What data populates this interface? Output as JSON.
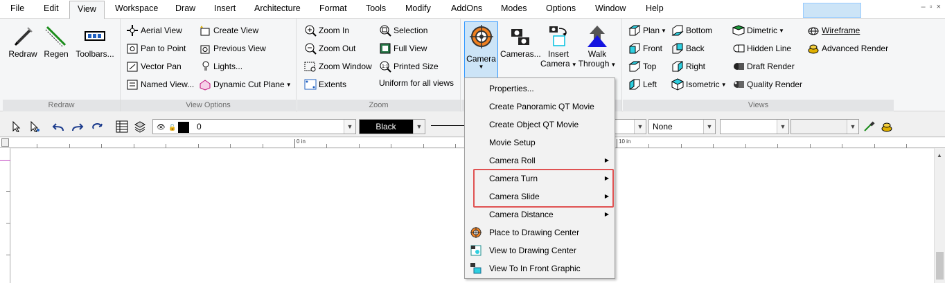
{
  "menubar": {
    "items": [
      "File",
      "Edit",
      "View",
      "Workspace",
      "Draw",
      "Insert",
      "Architecture",
      "Format",
      "Tools",
      "Modify",
      "AddOns",
      "Modes",
      "Options",
      "Window",
      "Help"
    ],
    "active": "View",
    "window_controls": [
      "–",
      "▫",
      "×"
    ]
  },
  "ribbon": {
    "redraw": {
      "label": "Redraw",
      "buttons": [
        "Redraw",
        "Regen",
        "Toolbars..."
      ]
    },
    "view_options": {
      "label": "View Options",
      "col1": [
        "Aerial View",
        "Pan to Point",
        "Vector Pan",
        "Named View..."
      ],
      "col2": [
        "Create View",
        "Previous View",
        "Lights...",
        "Dynamic Cut Plane"
      ]
    },
    "zoom": {
      "label": "Zoom",
      "col1": [
        "Zoom In",
        "Zoom Out",
        "Zoom Window",
        "Extents"
      ],
      "col2": [
        "Selection",
        "Full View",
        "Printed Size",
        "Uniform for all views"
      ]
    },
    "camera": {
      "camera": "Camera",
      "cameras": "Cameras...",
      "insert_camera_1": "Insert",
      "insert_camera_2": "Camera",
      "walk_through_1": "Walk",
      "walk_through_2": "Through"
    },
    "views": {
      "label": "Views",
      "col1": [
        "Plan",
        "Front",
        "Top",
        "Left"
      ],
      "col2": [
        "Bottom",
        "Back",
        "Right",
        "Isometric"
      ],
      "col3": [
        "Dimetric",
        "Hidden Line",
        "Draft Render",
        "Quality Render"
      ],
      "col4": [
        "Wireframe",
        "Advanced Render"
      ]
    }
  },
  "toolbar": {
    "layer_value": "0",
    "color_value": "Black",
    "fill_value": "None"
  },
  "ruler": {
    "label_0": "0 in",
    "label_10": "10 in"
  },
  "camera_menu": {
    "items": [
      {
        "label": "Properties...",
        "submenu": false
      },
      {
        "label": "Create Panoramic QT Movie",
        "submenu": false
      },
      {
        "label": "Create Object QT Movie",
        "submenu": false
      },
      {
        "label": "Movie Setup",
        "submenu": false
      },
      {
        "label": "Camera Roll",
        "submenu": true
      },
      {
        "label": "Camera Turn",
        "submenu": true
      },
      {
        "label": "Camera Slide",
        "submenu": true
      },
      {
        "label": "Camera Distance",
        "submenu": true
      },
      {
        "label": "Place to Drawing Center",
        "submenu": false
      },
      {
        "label": "View to Drawing Center",
        "submenu": false
      },
      {
        "label": "View To In Front Graphic",
        "submenu": false
      }
    ]
  },
  "colors": {
    "accent": "#3399ff",
    "selected_bg": "#cce4f7",
    "highlight_box": "#e05252"
  }
}
